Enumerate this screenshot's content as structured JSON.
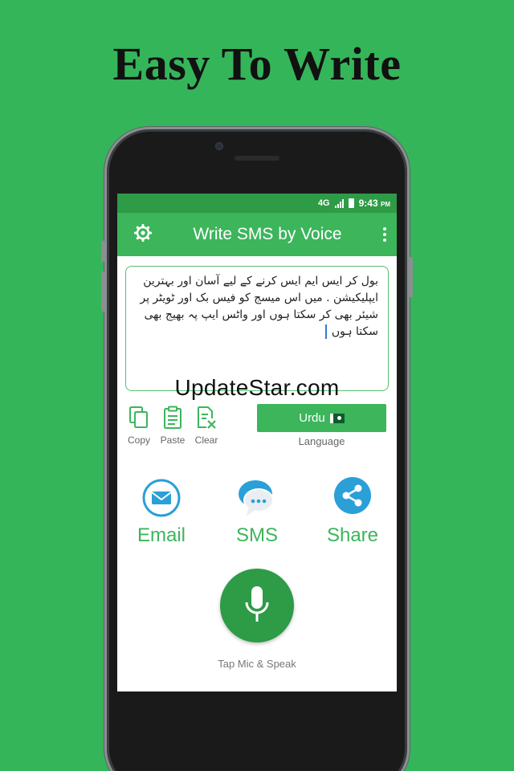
{
  "headline": "Easy To Write",
  "status": {
    "network": "4G",
    "time": "9:43",
    "time_suffix": "PM"
  },
  "appbar": {
    "title": "Write SMS by Voice",
    "settings_icon": "gear-icon",
    "menu_icon": "more-vert-icon"
  },
  "message": {
    "lines": [
      "بول کر ایس ایم ایس کرنے کے لیے آسان اور بہترین",
      "ایپلیکیشن . میں اس میسج کو فیس بک اور ٹویٹر پر",
      "شیئر بھی کر سکتا ہوں  اور واٹس ایپ پہ بھیج بھی",
      "سکتا ہوں"
    ]
  },
  "watermark": "UpdateStar.com",
  "tools": [
    {
      "label": "Copy",
      "icon": "copy-icon"
    },
    {
      "label": "Paste",
      "icon": "paste-icon"
    },
    {
      "label": "Clear",
      "icon": "clear-icon"
    }
  ],
  "language": {
    "button_label": "Urdu",
    "caption": "Language",
    "flag_icon": "pakistan-flag-icon"
  },
  "share": {
    "email_label": "Email",
    "sms_label": "SMS",
    "share_label": "Share"
  },
  "mic": {
    "caption": "Tap Mic & Speak",
    "icon": "microphone-icon"
  },
  "colors": {
    "background": "#35b559",
    "appbar": "#3cb55b",
    "statusbar": "#2e9b46",
    "accent_blue": "#2a9fd8"
  }
}
